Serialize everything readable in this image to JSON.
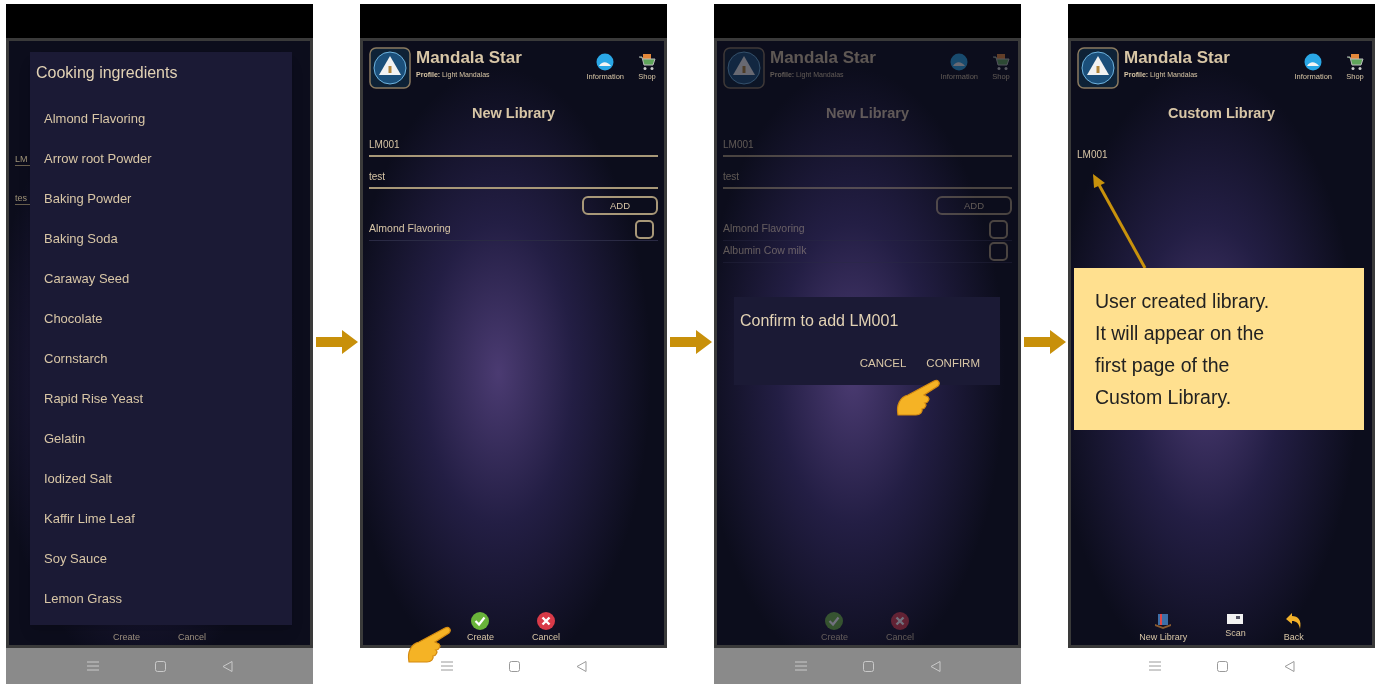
{
  "panels": [
    {
      "kind": "picker",
      "field_hints": [
        "LM",
        "tes"
      ],
      "dialog": {
        "title": "Cooking ingredients",
        "items": [
          "Almond Flavoring",
          "Arrow root Powder",
          "Baking Powder",
          "Baking Soda",
          "Caraway Seed",
          "Chocolate",
          "Cornstarch",
          "Rapid Rise Yeast",
          "Gelatin",
          "Iodized Salt",
          "Kaffir Lime Leaf",
          "Soy Sauce",
          "Lemon Grass"
        ]
      },
      "actions": [
        {
          "label": "Create"
        },
        {
          "label": "Cancel"
        }
      ]
    },
    {
      "kind": "form",
      "header": {
        "title": "Mandala Star",
        "profile": "**Profile:** Light Mandalas",
        "links": [
          {
            "kind": "info",
            "label": "Information"
          },
          {
            "kind": "shop",
            "label": "Shop"
          }
        ]
      },
      "page_title": "New Library",
      "fields": [
        "LM001",
        "test"
      ],
      "add_button": "ADD",
      "rows": [
        {
          "label": "Almond Flavoring",
          "checked": false
        }
      ],
      "actions": [
        {
          "kind": "check",
          "label": "Create"
        },
        {
          "kind": "cross",
          "label": "Cancel"
        }
      ]
    },
    {
      "kind": "confirm",
      "header": {
        "title": "Mandala Star",
        "profile": "**Profile:** Light Mandalas",
        "links": [
          {
            "kind": "info",
            "label": "Information"
          },
          {
            "kind": "shop",
            "label": "Shop"
          }
        ]
      },
      "page_title": "New Library",
      "fields": [
        "LM001",
        "test"
      ],
      "add_button": "ADD",
      "rows": [
        {
          "label": "Almond Flavoring",
          "checked": false
        },
        {
          "label": "Albumin Cow milk",
          "checked": false
        }
      ],
      "actions": [
        {
          "kind": "check",
          "label": "Create"
        },
        {
          "kind": "cross",
          "label": "Cancel"
        }
      ],
      "dialog": {
        "title": "Confirm to add LM001",
        "buttons": [
          "CANCEL",
          "CONFIRM"
        ]
      }
    },
    {
      "kind": "library",
      "header": {
        "title": "Mandala Star",
        "profile": "**Profile:** Light Mandalas",
        "links": [
          {
            "kind": "info",
            "label": "Information"
          },
          {
            "kind": "shop",
            "label": "Shop"
          }
        ]
      },
      "page_title": "Custom Library",
      "libraries": [
        "LM001"
      ],
      "note": "User created library.\nIt will appear on the\nfirst page of the\nCustom Library.",
      "actions": [
        {
          "kind": "book",
          "label": "New Library"
        },
        {
          "kind": "scan",
          "label": "Scan"
        },
        {
          "kind": "back",
          "label": "Back"
        }
      ]
    }
  ]
}
